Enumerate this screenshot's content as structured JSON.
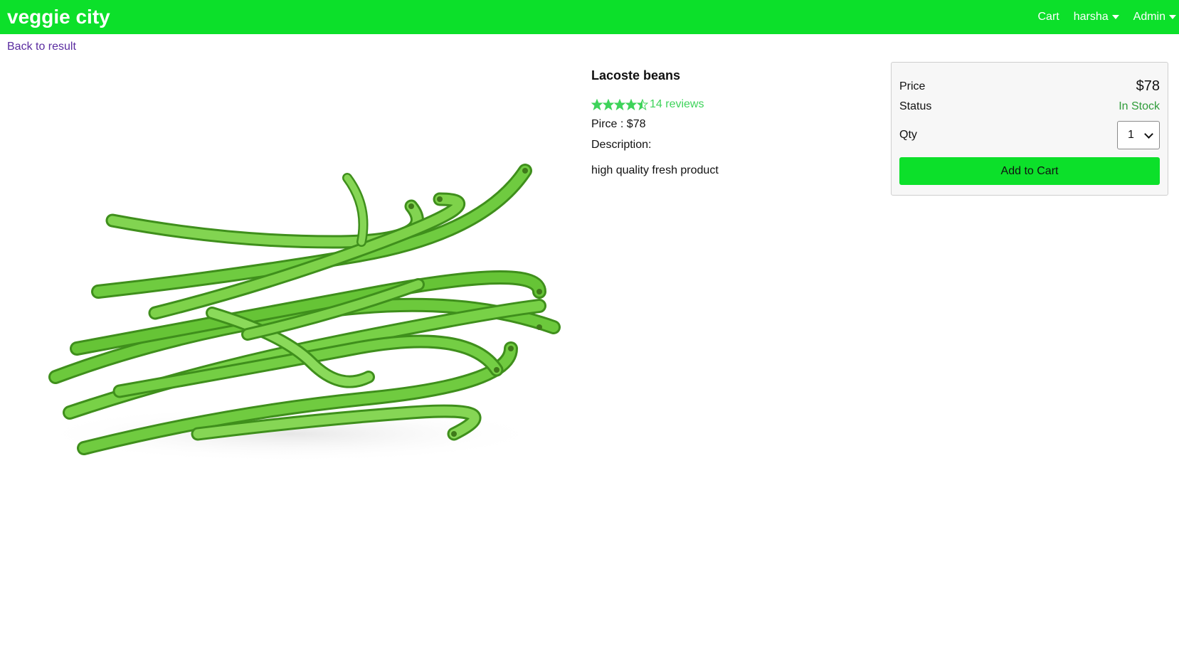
{
  "header": {
    "brand": "veggie city",
    "nav": {
      "cart": "Cart",
      "user": "harsha",
      "admin": "Admin"
    },
    "color": "#0ce02a"
  },
  "back_link": "Back to result",
  "product": {
    "name": "Lacoste beans",
    "rating": 4.5,
    "reviews_label": "14 reviews",
    "price_line": "Pirce : $78",
    "description_label": "Description:",
    "description": "high quality fresh product",
    "image_icon": "green-beans-image"
  },
  "card": {
    "price_label": "Price",
    "price_value": "$78",
    "status_label": "Status",
    "status_value": "In Stock",
    "qty_label": "Qty",
    "qty_selected": "1",
    "add_button": "Add to Cart"
  },
  "colors": {
    "accent": "#0ce02a",
    "star": "#3ed35a",
    "in_stock": "#2f9c3a",
    "link": "#5a2ca0"
  }
}
